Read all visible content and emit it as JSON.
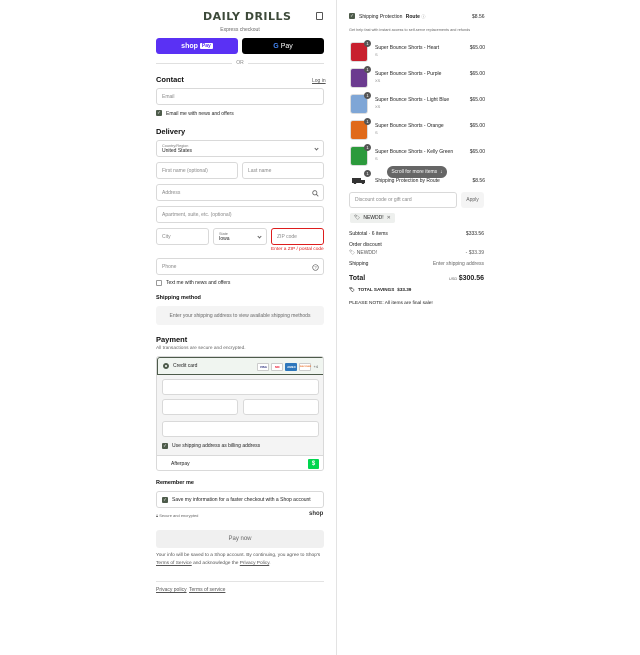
{
  "brand": "DAILY DRILLS",
  "express": {
    "title": "Express checkout",
    "shop_pay_label": "shop",
    "shop_pay_badge": "Pay",
    "gpay_g": "G",
    "gpay_label": "Pay",
    "or": "OR"
  },
  "contact": {
    "title": "Contact",
    "login": "Log in",
    "email_placeholder": "Email",
    "news_label": "Email me with news and offers"
  },
  "delivery": {
    "title": "Delivery",
    "country_label": "Country/Region",
    "country_value": "United States",
    "first_name": "First name (optional)",
    "last_name": "Last name",
    "address": "Address",
    "apartment": "Apartment, suite, etc. (optional)",
    "city": "City",
    "state_label": "State",
    "state_value": "Iowa",
    "zip": "ZIP code",
    "zip_error": "Enter a ZIP / postal code",
    "phone": "Phone",
    "text_label": "Text me with news and offers"
  },
  "shipping_method": {
    "title": "Shipping method",
    "notice": "Enter your shipping address to view available shipping methods"
  },
  "payment": {
    "title": "Payment",
    "subtitle": "All transactions are secure and encrypted.",
    "credit_card": "Credit card",
    "card_icons": [
      "VISA",
      "MC",
      "AMEX",
      "DISCOVER"
    ],
    "more_cards": "+4",
    "billing_label": "Use shipping address as billing address",
    "afterpay": "Afterpay",
    "afterpay_icon": "$"
  },
  "remember": {
    "title": "Remember me",
    "save_label": "Save my information for a faster checkout with a Shop account",
    "secure": "Secure and encrypted",
    "shop": "shop"
  },
  "pay_now": "Pay now",
  "legal": {
    "line1": "Your info will be saved to a Shop account. By continuing, you agree to Shop's",
    "terms": "Terms of Service",
    "mid": "and acknowledge the",
    "privacy": "Privacy Policy",
    "end": "."
  },
  "footer": {
    "privacy": "Privacy policy",
    "terms": "Terms of service"
  },
  "summary": {
    "protection_label": "Shipping Protection",
    "route": "Route",
    "protection_price": "$8.56",
    "protection_desc": "Get help fast with instant access to self-serve replacements and refunds",
    "items": [
      {
        "name": "Super Bounce Shorts - Heart",
        "variant": "S",
        "price": "$65.00",
        "qty": "1",
        "color": "#c8202e"
      },
      {
        "name": "Super Bounce Shorts - Purple",
        "variant": "XS",
        "price": "$65.00",
        "qty": "1",
        "color": "#6b3b8f"
      },
      {
        "name": "Super Bounce Shorts - Light Blue",
        "variant": "XS",
        "price": "$65.00",
        "qty": "1",
        "color": "#7fa6d6"
      },
      {
        "name": "Super Bounce Shorts - Orange",
        "variant": "S",
        "price": "$65.00",
        "qty": "1",
        "color": "#e06a1a"
      },
      {
        "name": "Super Bounce Shorts - Kelly Green",
        "variant": "S",
        "price": "$65.00",
        "qty": "1",
        "color": "#2c9a3c"
      }
    ],
    "route_item": {
      "name": "Shipping Protection by Route",
      "price": "$8.56",
      "qty": "1"
    },
    "scroll_pill": "Scroll for more items",
    "discount_placeholder": "Discount code or gift card",
    "apply": "Apply",
    "code": "NEWDD!",
    "subtotal_label": "Subtotal · 6 items",
    "subtotal_value": "$333.56",
    "order_discount_label": "Order discount",
    "discount_code": "NEWDD!",
    "discount_value": "- $33.39",
    "shipping_label": "Shipping",
    "shipping_value": "Enter shipping address",
    "total_label": "Total",
    "currency": "USD",
    "total_value": "$300.56",
    "savings_label": "TOTAL SAVINGS",
    "savings_value": "$33.39",
    "note": "PLEASE NOTE: All items are final sale!"
  }
}
